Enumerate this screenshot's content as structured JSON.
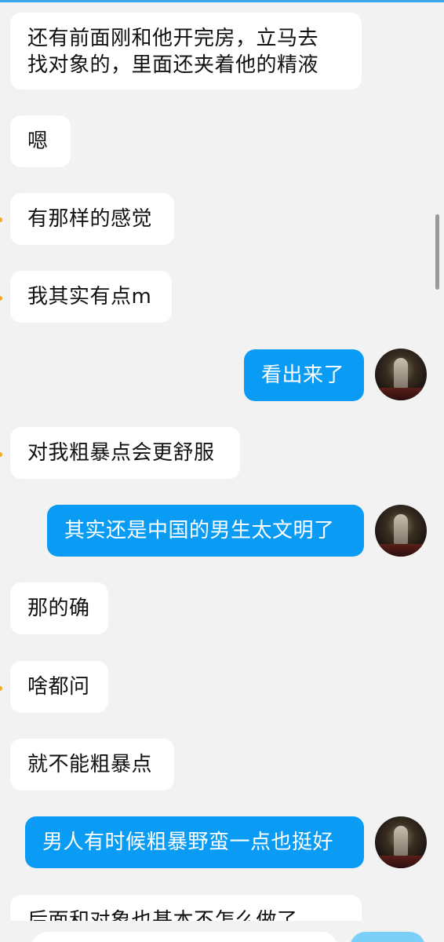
{
  "messages": [
    {
      "side": "received",
      "text": "还有前面刚和他开完房，立马去\n找对象的，里面还夹着他的精液"
    },
    {
      "side": "received",
      "text": "嗯"
    },
    {
      "side": "received",
      "text": "有那样的感觉"
    },
    {
      "side": "received",
      "text": "我其实有点m"
    },
    {
      "side": "sent",
      "text": "看出来了"
    },
    {
      "side": "received",
      "text": "对我粗暴点会更舒服"
    },
    {
      "side": "sent",
      "text": "其实还是中国的男生太文明了"
    },
    {
      "side": "received",
      "text": "那的确"
    },
    {
      "side": "received",
      "text": "啥都问"
    },
    {
      "side": "received",
      "text": "就不能粗暴点"
    },
    {
      "side": "sent",
      "text": "男人有时候粗暴野蛮一点也挺好"
    },
    {
      "side": "received",
      "text": "后面和对象也基本不怎么做了"
    }
  ],
  "colors": {
    "background": "#f2f2f2",
    "received_bubble": "#ffffff",
    "sent_bubble": "#0a9cf5",
    "send_button": "#7ccff7"
  },
  "icons": {
    "avatar": "user-avatar-photo"
  }
}
